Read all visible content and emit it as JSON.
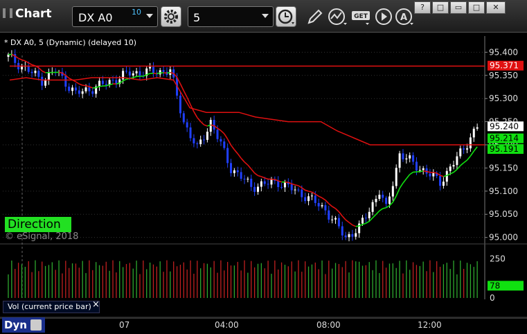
{
  "window": {
    "title": "Chart",
    "symbol": "DX A0",
    "symbol_superscript": "10",
    "interval": "5",
    "buttons": {
      "help": "?",
      "restore": "□",
      "minimize": "▭",
      "close": "✕"
    }
  },
  "chart": {
    "study_label": "* DX A0, 5 (Dynamic) (delayed 10)",
    "direction_label": "Direction",
    "copyright": "© eSignal, 2018",
    "volume_label": "Vol (current price bar)",
    "bottom_label": "Dyn",
    "close_icon": "×"
  },
  "colors": {
    "up_candle": "#ffffff",
    "down_candle": "#2040ff",
    "red_line": "#e01010",
    "green_line": "#10e010",
    "vol_up": "#2ea82e",
    "vol_down": "#c02020",
    "direction_bg": "#22e022"
  },
  "chart_data": {
    "type": "line",
    "y_ticks": [
      "95.400",
      "95.350",
      "95.300",
      "95.250",
      "95.200",
      "95.150",
      "95.100",
      "95.050",
      "95.000"
    ],
    "y_tick_values": [
      95.4,
      95.35,
      95.3,
      95.25,
      95.2,
      95.15,
      95.1,
      95.05,
      95.0
    ],
    "ylim": [
      94.995,
      95.42
    ],
    "x_ticks": [
      "07",
      "04:00",
      "08:00",
      "12:00"
    ],
    "price_labels": [
      {
        "text": "95.371",
        "value": 95.371,
        "color": "#e01010"
      },
      {
        "text": "95.240",
        "value": 95.24,
        "color": "#ffffff"
      },
      {
        "text": "95.214",
        "value": 95.214,
        "color": "#10e010"
      },
      {
        "text": "95.191",
        "value": 95.191,
        "color": "#10e010"
      }
    ],
    "series": [
      {
        "values": [
          95.37,
          95.37,
          95.37,
          95.37,
          95.37,
          95.37,
          95.37,
          95.37,
          95.37,
          95.37,
          95.37,
          95.37,
          95.37,
          95.37,
          95.37,
          95.37,
          95.37,
          95.37,
          95.37,
          95.37,
          95.37,
          95.37,
          95.37,
          95.37,
          95.37,
          95.37,
          95.37,
          95.37,
          95.37,
          95.37
        ]
      },
      {
        "values": [
          95.34,
          95.345,
          95.34,
          95.34,
          95.34,
          95.345,
          95.345,
          95.345,
          95.34,
          95.345,
          95.34,
          95.28,
          95.27,
          95.27,
          95.27,
          95.26,
          95.255,
          95.25,
          95.25,
          95.25,
          95.23,
          95.215,
          95.2,
          95.2,
          95.2,
          95.2,
          95.2,
          95.2,
          95.2,
          95.2
        ]
      }
    ],
    "volume_ticks": [
      "250",
      "78",
      "0"
    ],
    "volume_tick_values": [
      250,
      78,
      0
    ]
  }
}
